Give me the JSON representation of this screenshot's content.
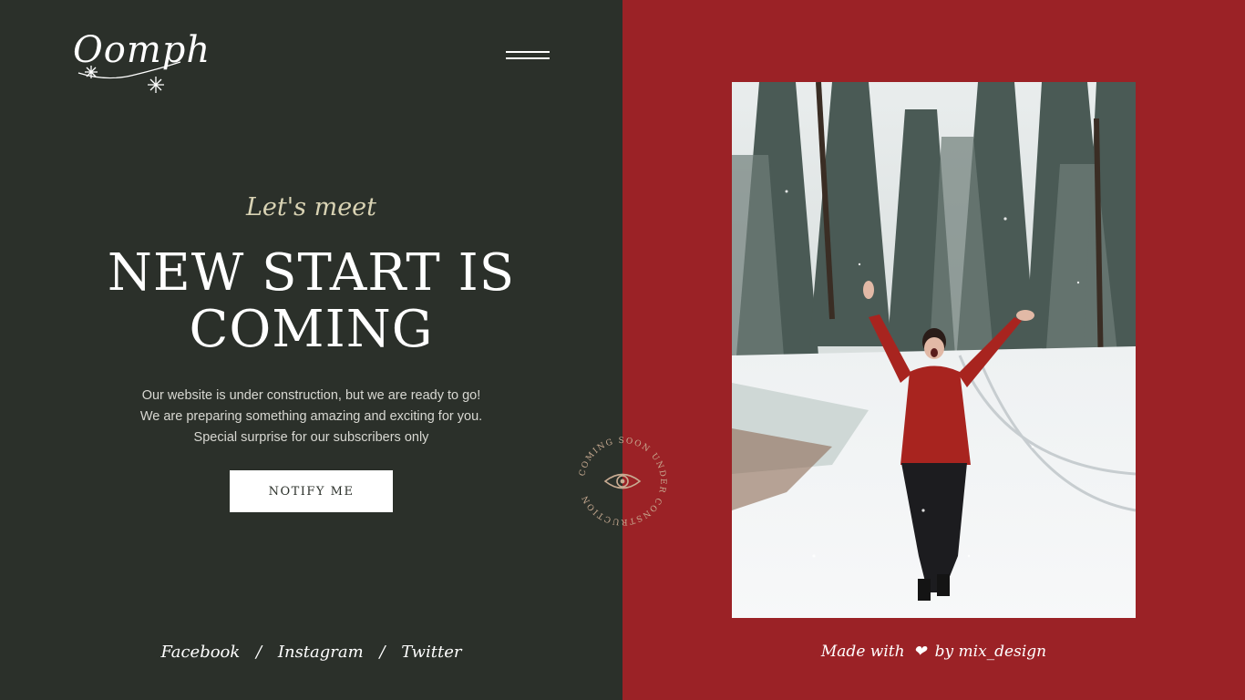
{
  "logo": {
    "text": "Oomph"
  },
  "hero": {
    "kicker": "Let's meet",
    "headline_line1": "NEW START IS",
    "headline_line2": "COMING",
    "desc_lines": [
      "Our website is under construction, but we are ready to go!",
      "We are preparing something amazing and exciting for you.",
      "Special surprise for our subscribers only"
    ],
    "cta_label": "NOTIFY ME"
  },
  "social": {
    "links": [
      "Facebook",
      "Instagram",
      "Twitter"
    ],
    "separator": "/"
  },
  "badge": {
    "text": "COMING SOON UNDER CONSTRUCTION"
  },
  "credit": {
    "prefix": "Made with",
    "suffix": "by mix_design"
  },
  "colors": {
    "left_bg": "#2b302a",
    "right_bg": "#9b2226",
    "accent": "#d9d3b4"
  },
  "icons": {
    "menu": "hamburger-menu-icon",
    "badge": "eye-icon",
    "heart": "heart-icon",
    "snowflake": "snowflake-icon"
  }
}
